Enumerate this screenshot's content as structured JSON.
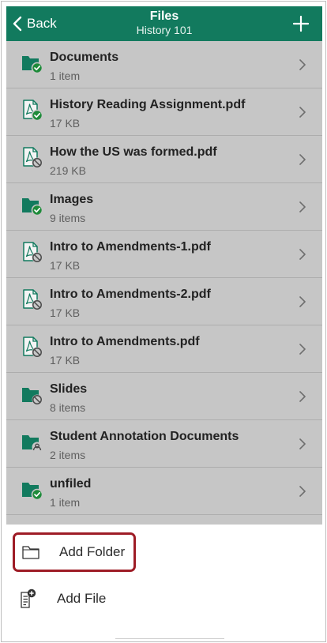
{
  "header": {
    "back_label": "Back",
    "title": "Files",
    "subtitle": "History 101"
  },
  "files": [
    {
      "name": "Documents",
      "meta": "1 item",
      "icon": "folder-published-icon"
    },
    {
      "name": "History Reading Assignment.pdf",
      "meta": "17 KB",
      "icon": "pdf-published-icon"
    },
    {
      "name": "How the US was formed.pdf",
      "meta": "219 KB",
      "icon": "pdf-unpublished-icon"
    },
    {
      "name": "Images",
      "meta": "9 items",
      "icon": "folder-published-icon"
    },
    {
      "name": "Intro to Amendments-1.pdf",
      "meta": "17 KB",
      "icon": "pdf-unpublished-icon"
    },
    {
      "name": "Intro to Amendments-2.pdf",
      "meta": "17 KB",
      "icon": "pdf-unpublished-icon"
    },
    {
      "name": "Intro to Amendments.pdf",
      "meta": "17 KB",
      "icon": "pdf-unpublished-icon"
    },
    {
      "name": "Slides",
      "meta": "8 items",
      "icon": "folder-unpublished-icon"
    },
    {
      "name": "Student Annotation Documents",
      "meta": "2 items",
      "icon": "folder-restricted-icon"
    },
    {
      "name": "unfiled",
      "meta": "1 item",
      "icon": "folder-published-icon"
    }
  ],
  "actions": {
    "add_folder": "Add Folder",
    "add_file": "Add File"
  },
  "colors": {
    "brand": "#127a5e",
    "published": "#1e8b3a",
    "highlight": "#9e1c26"
  }
}
